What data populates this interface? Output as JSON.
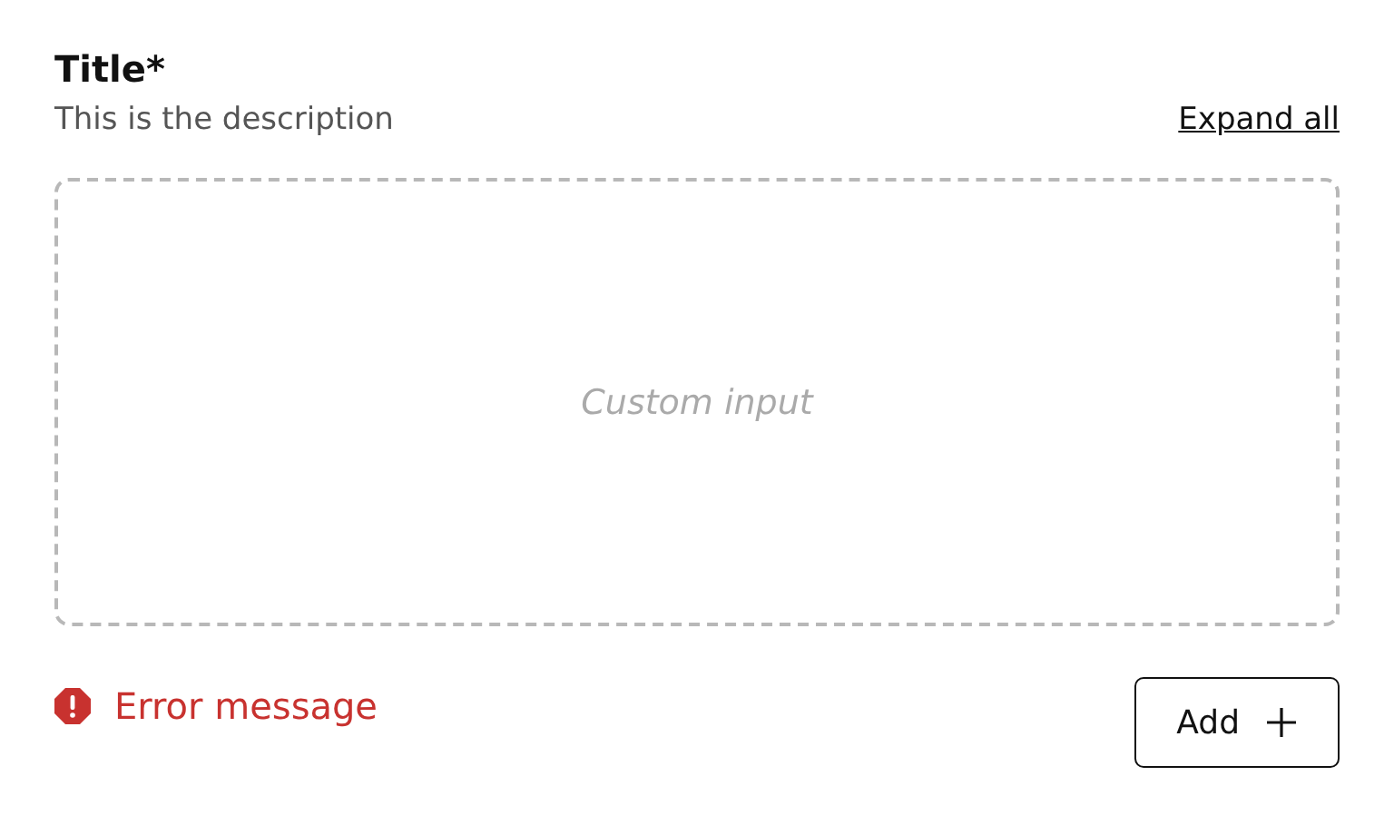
{
  "field": {
    "title": "Title*",
    "description": "This is the description",
    "expand_link": "Expand all"
  },
  "custom_input": {
    "placeholder": "Custom input"
  },
  "error": {
    "message": "Error message"
  },
  "add_button": {
    "label": "Add"
  }
}
